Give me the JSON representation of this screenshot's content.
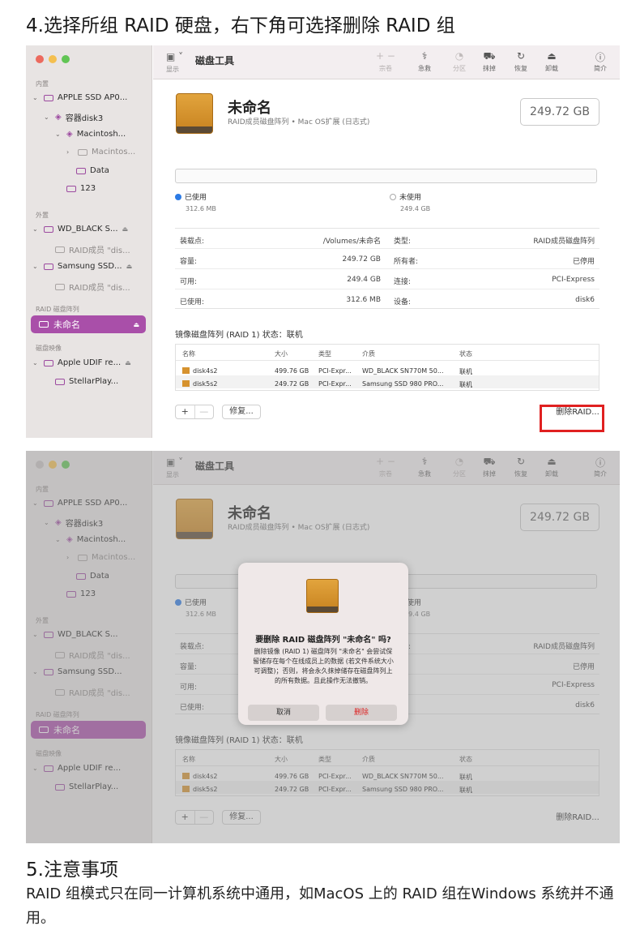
{
  "heading4": "4.选择所组 RAID 硬盘，右下角可选择删除 RAID 组",
  "heading5": "5.注意事项",
  "note": "RAID 组模式只在同一计算机系统中通用，如MacOS 上的 RAID 组在Windows 系统并不通用。",
  "app": {
    "title": "磁盘工具",
    "show_label": "显示",
    "toolbar": [
      {
        "icon": "plus-icon",
        "label": "宗卷",
        "dim": true
      },
      {
        "icon": "stethoscope-icon",
        "label": "急救",
        "dim": false
      },
      {
        "icon": "pie-chart-icon",
        "label": "分区",
        "dim": true
      },
      {
        "icon": "erase-icon",
        "label": "抹掉",
        "dim": false
      },
      {
        "icon": "restore-icon",
        "label": "恢复",
        "dim": false
      },
      {
        "icon": "eject-icon",
        "label": "卸载",
        "dim": false
      },
      {
        "icon": "info-icon",
        "label": "简介",
        "dim": false
      }
    ],
    "sidebar": {
      "internal_label": "内置",
      "external_label": "外置",
      "raid_label": "RAID 磁盘阵列",
      "image_label": "磁盘映像",
      "items": {
        "apple_ssd": "APPLE SSD AP0...",
        "container": "容器disk3",
        "macintosh": "Macintosh...",
        "macintos2": "Macintos...",
        "data": "Data",
        "v123": "123",
        "wd_black": "WD_BLACK S...",
        "raid_member1": "RAID成员 \"dis...",
        "samsung": "Samsung SSD...",
        "raid_member2": "RAID成员 \"dis...",
        "selected": "未命名",
        "apple_udif": "Apple UDIF re...",
        "stellar": "StellarPlay..."
      }
    },
    "volume": {
      "name": "未命名",
      "subtitle": "RAID成员磁盘阵列 • Mac OS扩展 (日志式)",
      "capacity": "249.72 GB",
      "used_label": "已使用",
      "used_value": "312.6 MB",
      "free_label": "未使用",
      "free_value": "249.4 GB"
    },
    "info": {
      "mount_label": "装载点:",
      "mount_value": "/Volumes/未命名",
      "type_label": "类型:",
      "type_value": "RAID成员磁盘阵列",
      "capacity_label": "容量:",
      "capacity_value": "249.72 GB",
      "owner_label": "所有者:",
      "owner_value": "已停用",
      "available_label": "可用:",
      "available_value": "249.4 GB",
      "connection_label": "连接:",
      "connection_value": "PCI-Express",
      "used_label": "已使用:",
      "used_value": "312.6 MB",
      "device_label": "设备:",
      "device_value": "disk6"
    },
    "raid": {
      "status_label": "镜像磁盘阵列 (RAID 1) 状态：联机",
      "headers": [
        "名称",
        "大小",
        "类型",
        "介质",
        "状态"
      ],
      "rows": [
        [
          "disk4s2",
          "499.76 GB",
          "PCI-Expr...",
          "WD_BLACK SN770M 50...",
          "联机"
        ],
        [
          "disk5s2",
          "249.72 GB",
          "PCI-Expr...",
          "Samsung SSD 980 PRO...",
          "联机"
        ]
      ],
      "plus": "+",
      "minus": "—",
      "repair": "修复...",
      "delete": "删除RAID..."
    },
    "dialog": {
      "title": "要删除 RAID 磁盘阵列 \"未命名\" 吗?",
      "body": "删除镜像 (RAID 1) 磁盘阵列 \"未命名\" 会尝试保留储存在每个在线成员上的数据 (若文件系统大小可调整)；否则，将会永久抹掉储存在磁盘阵列上的所有数据。且此操作无法撤销。",
      "cancel": "取消",
      "delete": "删除"
    }
  }
}
